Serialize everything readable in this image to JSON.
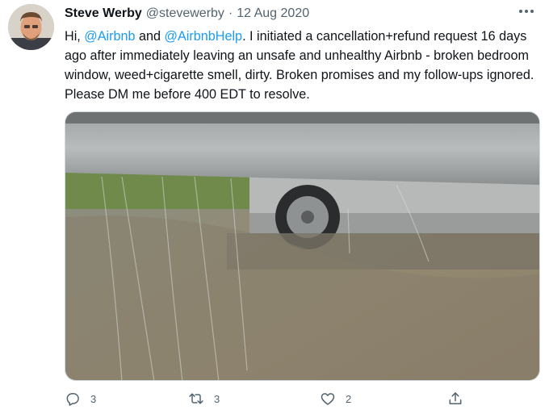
{
  "tweet": {
    "author_name": "Steve Werby",
    "author_handle": "@stevewerby",
    "separator": "·",
    "date": "12 Aug 2020",
    "text_parts": {
      "prefix": "Hi, ",
      "mention1": "@Airbnb",
      "and": " and ",
      "mention2": "@AirbnbHelp",
      "body": ". I initiated a cancellation+refund request 16 days ago after immediately leaving an unsafe and unhealthy Airbnb - broken bedroom window, weed+cigarette smell, dirty. Broken promises and my follow-ups ignored. Please DM me before 400 EDT to resolve."
    },
    "colors": {
      "link": "#1d9bf0",
      "muted": "#536471"
    }
  },
  "actions": {
    "reply_count": "3",
    "retweet_count": "3",
    "like_count": "2",
    "icons": [
      "reply-icon",
      "retweet-icon",
      "like-icon",
      "share-icon"
    ]
  },
  "menu": {
    "icon": "more-icon"
  }
}
